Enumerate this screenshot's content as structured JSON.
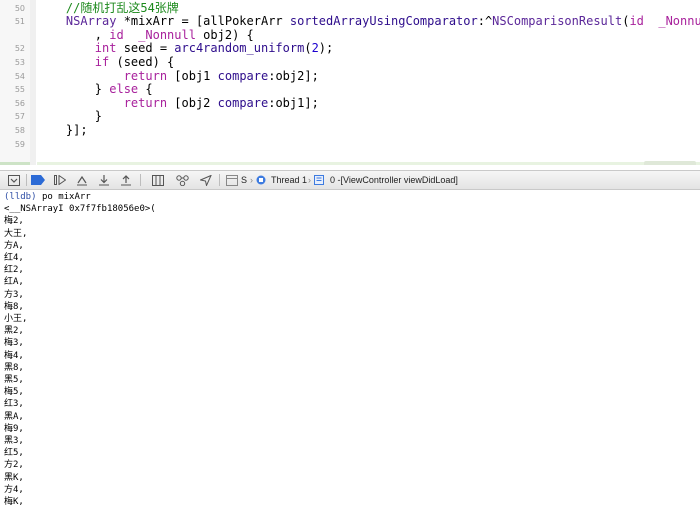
{
  "editor": {
    "lines": [
      {
        "num": "50",
        "tokens": [
          {
            "t": "    ",
            "c": "plain"
          },
          {
            "t": "//随机打乱这54张牌",
            "c": "comment"
          }
        ]
      },
      {
        "num": "51",
        "tokens": [
          {
            "t": "    ",
            "c": "plain"
          },
          {
            "t": "NSArray",
            "c": "type"
          },
          {
            "t": " *mixArr = [allPokerArr ",
            "c": "plain"
          },
          {
            "t": "sortedArrayUsingComparator",
            "c": "method"
          },
          {
            "t": ":^",
            "c": "plain"
          },
          {
            "t": "NSComparisonResult",
            "c": "type"
          },
          {
            "t": "(",
            "c": "plain"
          },
          {
            "t": "id",
            "c": "keyword"
          },
          {
            "t": "  ",
            "c": "plain"
          },
          {
            "t": "_Nonnull",
            "c": "keyword"
          }
        ]
      },
      {
        "num": "",
        "tokens": [
          {
            "t": "        , ",
            "c": "plain"
          },
          {
            "t": "id",
            "c": "keyword"
          },
          {
            "t": "  ",
            "c": "plain"
          },
          {
            "t": "_Nonnull",
            "c": "keyword"
          },
          {
            "t": " obj2) {",
            "c": "plain"
          }
        ]
      },
      {
        "num": "52",
        "tokens": [
          {
            "t": "        ",
            "c": "plain"
          },
          {
            "t": "int",
            "c": "keyword"
          },
          {
            "t": " seed = ",
            "c": "plain"
          },
          {
            "t": "arc4random_uniform",
            "c": "method"
          },
          {
            "t": "(",
            "c": "plain"
          },
          {
            "t": "2",
            "c": "number"
          },
          {
            "t": ");",
            "c": "plain"
          }
        ]
      },
      {
        "num": "53",
        "tokens": [
          {
            "t": "        ",
            "c": "plain"
          },
          {
            "t": "if",
            "c": "keyword"
          },
          {
            "t": " (seed) {",
            "c": "plain"
          }
        ]
      },
      {
        "num": "54",
        "tokens": [
          {
            "t": "            ",
            "c": "plain"
          },
          {
            "t": "return",
            "c": "keyword"
          },
          {
            "t": " [obj1 ",
            "c": "plain"
          },
          {
            "t": "compare",
            "c": "method"
          },
          {
            "t": ":obj2];",
            "c": "plain"
          }
        ]
      },
      {
        "num": "55",
        "tokens": [
          {
            "t": "        } ",
            "c": "plain"
          },
          {
            "t": "else",
            "c": "keyword"
          },
          {
            "t": " {",
            "c": "plain"
          }
        ]
      },
      {
        "num": "56",
        "tokens": [
          {
            "t": "            ",
            "c": "plain"
          },
          {
            "t": "return",
            "c": "keyword"
          },
          {
            "t": " [obj2 ",
            "c": "plain"
          },
          {
            "t": "compare",
            "c": "method"
          },
          {
            "t": ":obj1];",
            "c": "plain"
          }
        ]
      },
      {
        "num": "57",
        "tokens": [
          {
            "t": "        }",
            "c": "plain"
          }
        ]
      },
      {
        "num": "58",
        "tokens": [
          {
            "t": "    }];",
            "c": "plain"
          }
        ]
      },
      {
        "num": "59",
        "tokens": [
          {
            "t": "",
            "c": "plain"
          }
        ]
      }
    ]
  },
  "debugbar": {
    "process": "S",
    "thread": "Thread 1",
    "frame": "0 -[ViewController viewDidLoad]"
  },
  "console": {
    "prompt": "(lldb)",
    "command": "po mixArr",
    "header": "<__NSArrayI 0x7f7fb18056e0>(",
    "items": [
      "梅2,",
      "大王,",
      "方A,",
      "红4,",
      "红2,",
      "红A,",
      "方3,",
      "梅8,",
      "小王,",
      "黑2,",
      "梅3,",
      "梅4,",
      "黑8,",
      "黑5,",
      "梅5,",
      "红3,",
      "黑A,",
      "梅9,",
      "黑3,",
      "红5,",
      "方2,",
      "黑K,",
      "方4,",
      "梅K,"
    ]
  },
  "colors": {
    "comment": "#1d8a1d",
    "keyword": "#a8219c",
    "type": "#5b2799",
    "method": "#2e0d8c",
    "accent": "#2c6bd6"
  }
}
